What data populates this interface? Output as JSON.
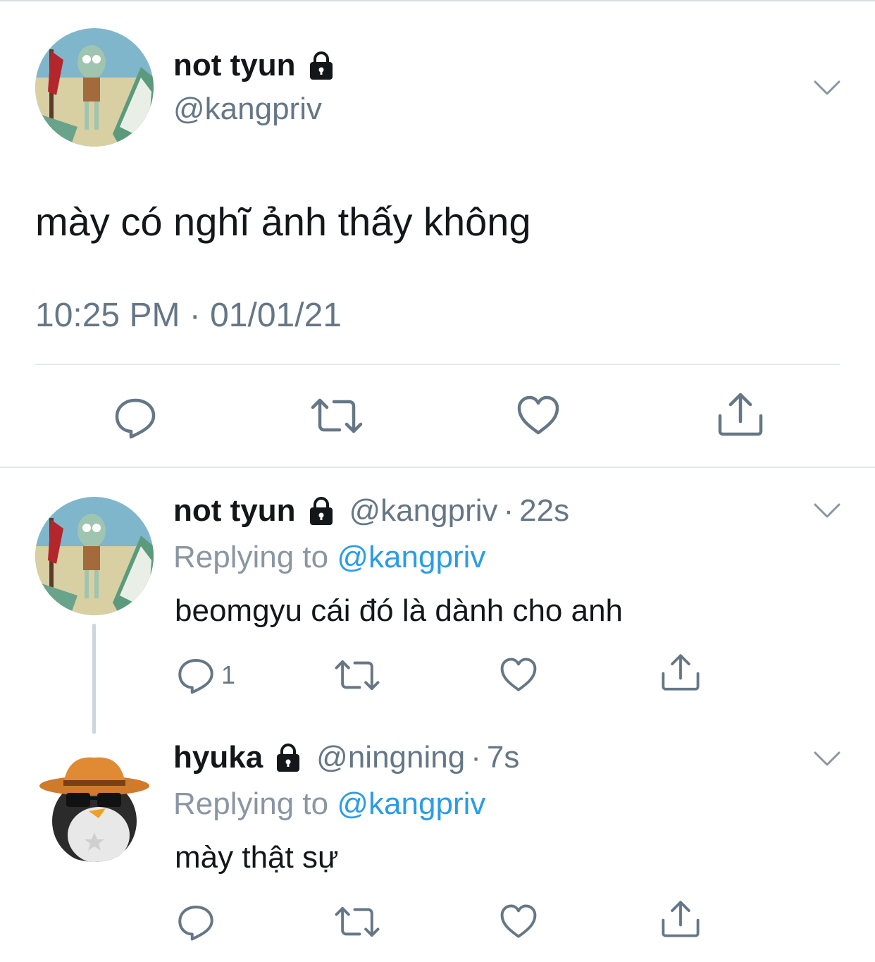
{
  "main_tweet": {
    "display_name": "not tyun",
    "handle": "@kangpriv",
    "text": "mày có nghĩ ảnh thấy không",
    "timestamp": "10:25 PM · 01/01/21"
  },
  "replies": [
    {
      "display_name": "not tyun",
      "handle": "@kangpriv",
      "time": "22s",
      "replying_prefix": "Replying to",
      "replying_to": "@kangpriv",
      "text": "beomgyu cái đó là dành cho anh",
      "reply_count": "1"
    },
    {
      "display_name": "hyuka",
      "handle": "@ningning",
      "time": "7s",
      "replying_prefix": "Replying to",
      "replying_to": "@kangpriv",
      "text": "mày thật sự",
      "reply_count": ""
    }
  ],
  "separator": "·",
  "icons": {
    "lock": "lock-icon",
    "chevron": "chevron-down-icon",
    "reply": "reply-icon",
    "retweet": "retweet-icon",
    "like": "heart-icon",
    "share": "share-icon"
  },
  "colors": {
    "text": "#14171a",
    "secondary": "#657786",
    "link": "#2b9ce6",
    "icon": "#657786",
    "divider": "#e1e8ed"
  }
}
